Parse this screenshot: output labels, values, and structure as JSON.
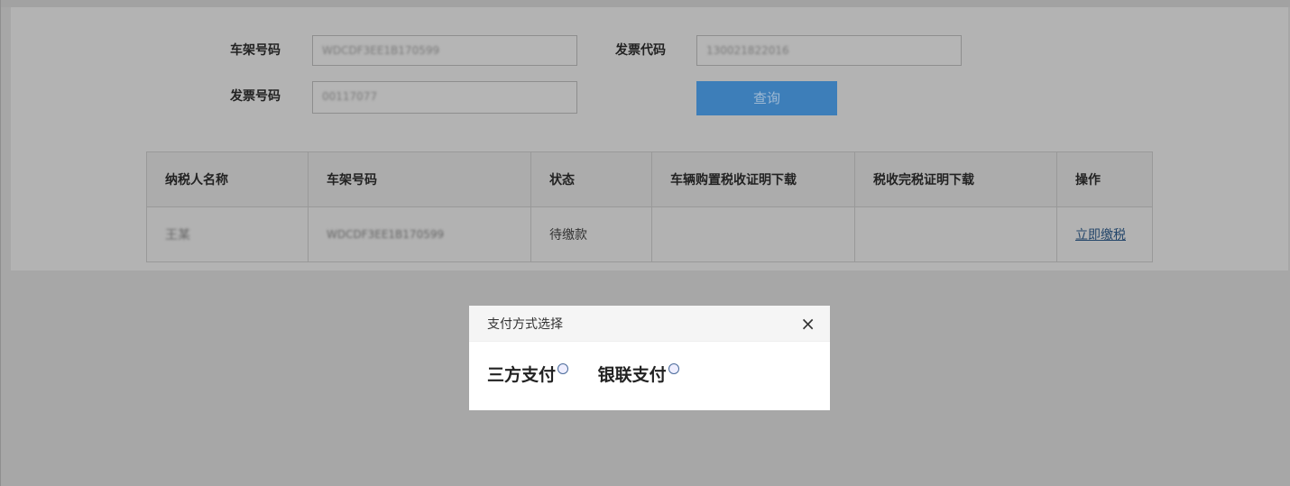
{
  "search": {
    "frame_label": "车架号码",
    "frame_value": "WDCDF3EE1B170599",
    "invoice_code_label": "发票代码",
    "invoice_code_value": "130021822016",
    "invoice_no_label": "发票号码",
    "invoice_no_value": "00117077",
    "query_label": "查询"
  },
  "table": {
    "headers": [
      "纳税人名称",
      "车架号码",
      "状态",
      "车辆购置税收证明下载",
      "税收完税证明下载",
      "操作"
    ],
    "rows": [
      {
        "name": "王某",
        "frame": "WDCDF3EE1B170599",
        "status": "待缴款",
        "cert1": "",
        "cert2": "",
        "action": "立即缴税"
      }
    ]
  },
  "modal": {
    "title": "支付方式选择",
    "close": "×",
    "options": [
      "三方支付",
      "银联支付"
    ]
  }
}
